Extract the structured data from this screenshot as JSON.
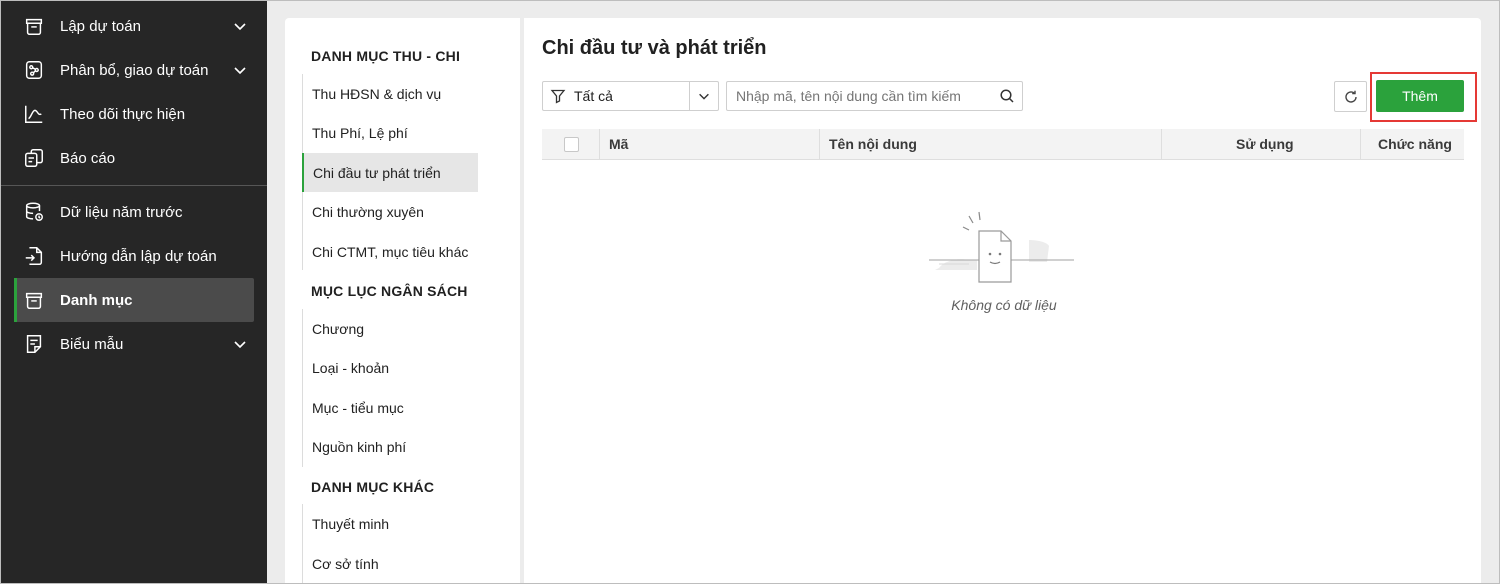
{
  "sidebar": {
    "items": [
      {
        "label": "Lập dự toán",
        "icon": "box-icon",
        "has_submenu": true
      },
      {
        "label": "Phân bổ, giao dự toán",
        "icon": "distribute-icon",
        "has_submenu": true
      },
      {
        "label": "Theo dõi thực hiện",
        "icon": "line-chart-icon",
        "has_submenu": false
      },
      {
        "label": "Báo cáo",
        "icon": "report-icon",
        "has_submenu": false
      },
      {
        "label": "Dữ liệu năm trước",
        "icon": "database-icon",
        "has_submenu": false
      },
      {
        "label": "Hướng dẫn lập dự toán",
        "icon": "guide-icon",
        "has_submenu": false
      },
      {
        "label": "Danh mục",
        "icon": "box-icon",
        "has_submenu": false,
        "active": true
      },
      {
        "label": "Biểu mẫu",
        "icon": "form-icon",
        "has_submenu": true
      }
    ]
  },
  "menu": {
    "groups": [
      {
        "title": "DANH MỤC THU - CHI",
        "items": [
          "Thu HĐSN & dịch vụ",
          "Thu Phí, Lệ phí",
          "Chi đầu tư phát triển",
          "Chi thường xuyên",
          "Chi CTMT, mục tiêu khác"
        ]
      },
      {
        "title": "MỤC LỤC NGÂN SÁCH",
        "items": [
          "Chương",
          "Loại - khoản",
          "Mục - tiểu mục",
          "Nguồn kinh phí"
        ]
      },
      {
        "title": "DANH MỤC KHÁC",
        "items": [
          "Thuyết minh",
          "Cơ sở tính"
        ]
      }
    ],
    "active_item": "Chi đầu tư phát triển"
  },
  "main": {
    "title": "Chi đầu tư và phát triển",
    "filter": {
      "value": "Tất cả"
    },
    "search": {
      "placeholder": "Nhập mã, tên nội dung cần tìm kiếm",
      "value": ""
    },
    "add_label": "Thêm",
    "table": {
      "columns": [
        "Mã",
        "Tên nội dung",
        "Sử dụng",
        "Chức năng"
      ],
      "rows": []
    },
    "empty_text": "Không có dữ liệu"
  },
  "colors": {
    "accent": "#2ba23c",
    "sidebar_bg": "#262626",
    "highlight_box": "#e53935"
  }
}
